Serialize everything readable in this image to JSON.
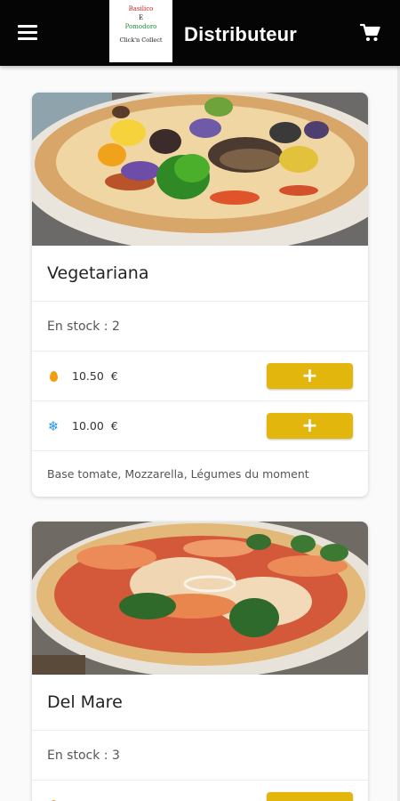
{
  "header": {
    "title": "Distributeur",
    "logo": {
      "line1": "Basilico",
      "line2": "E",
      "line3": "Pomodoro",
      "line4": "Click'n Collect"
    },
    "menu_icon": "menu-icon",
    "cart_icon": "cart-icon"
  },
  "products": [
    {
      "name": "Vegetariana",
      "stock": "En stock : 2",
      "price_hot": "10.50  €",
      "price_frozen": "10.00  €",
      "add_label": "+",
      "description": "Base tomate, Mozzarella, Légumes du moment"
    },
    {
      "name": "Del Mare",
      "stock": "En stock : 3"
    }
  ],
  "colors": {
    "appbar": "#050505",
    "accent": "#e2b60c",
    "hot": "#f39c12",
    "frozen": "#2196f3"
  }
}
